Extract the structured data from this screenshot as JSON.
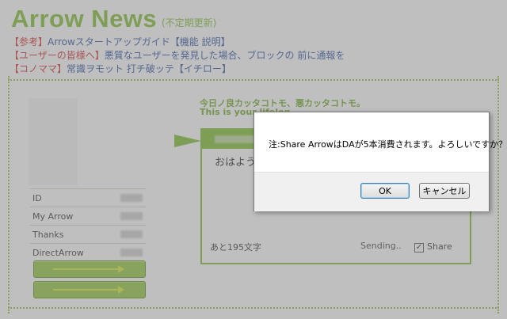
{
  "header": {
    "title": "Arrow News",
    "subtitle": "(不定期更新)"
  },
  "news": [
    {
      "tag": "【参考】",
      "text": "Arrowスタートアップガイド【機能 説明】"
    },
    {
      "tag": "【ユーザーの皆様へ】",
      "text": "悪質なユーザーを発見した場合、ブロックの 前に通報を"
    },
    {
      "tag": "【コノママ】",
      "text": "常識ヲモット 打チ破ッテ【イチロー】"
    }
  ],
  "profile": {
    "stats": [
      {
        "label": "ID"
      },
      {
        "label": "My Arrow"
      },
      {
        "label": "Thanks"
      },
      {
        "label": "DirectArrow"
      }
    ]
  },
  "timeline": {
    "tagline": "今日ノ良カッタコトモ、悪カッタコトモ。",
    "tagline2": "This is your lifelog."
  },
  "compose": {
    "text": "おはよう",
    "counter": "あと195文字",
    "status": "Sending..",
    "share_label": "Share",
    "share_check": "✓"
  },
  "dialog": {
    "message": "注:Share ArrowはDAが5本消費されます。よろしいですか？",
    "ok_label": "OK",
    "cancel_label": "キャンセル"
  },
  "colors": {
    "brand_green": "#7cbc2c",
    "link_blue": "#2a4ea0",
    "tag_red": "#d22b2b"
  }
}
